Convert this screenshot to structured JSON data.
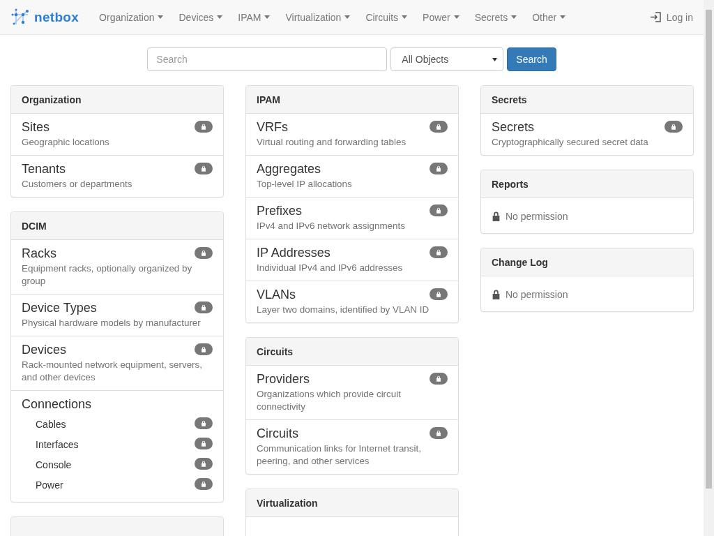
{
  "navbar": {
    "brand": "netbox",
    "menus": [
      {
        "label": "Organization"
      },
      {
        "label": "Devices"
      },
      {
        "label": "IPAM"
      },
      {
        "label": "Virtualization"
      },
      {
        "label": "Circuits"
      },
      {
        "label": "Power"
      },
      {
        "label": "Secrets"
      },
      {
        "label": "Other"
      }
    ],
    "login": "Log in"
  },
  "search": {
    "placeholder": "Search",
    "scope": "All Objects",
    "button": "Search"
  },
  "columns": [
    {
      "panels": [
        {
          "kind": "list",
          "title": "Organization",
          "items": [
            {
              "title": "Sites",
              "description": "Geographic locations",
              "locked": true
            },
            {
              "title": "Tenants",
              "description": "Customers or departments",
              "locked": true
            }
          ]
        },
        {
          "kind": "list",
          "title": "DCIM",
          "items": [
            {
              "title": "Racks",
              "description": "Equipment racks, optionally organized by group",
              "locked": true
            },
            {
              "title": "Device Types",
              "description": "Physical hardware models by manufacturer",
              "locked": true
            },
            {
              "title": "Devices",
              "description": "Rack-mounted network equipment, servers, and other devices",
              "locked": true
            },
            {
              "title": "Connections",
              "children": [
                {
                  "title": "Cables",
                  "locked": true
                },
                {
                  "title": "Interfaces",
                  "locked": true
                },
                {
                  "title": "Console",
                  "locked": true
                },
                {
                  "title": "Power",
                  "locked": true
                }
              ]
            }
          ]
        },
        {
          "kind": "list"
        }
      ]
    },
    {
      "panels": [
        {
          "kind": "list",
          "title": "IPAM",
          "items": [
            {
              "title": "VRFs",
              "description": "Virtual routing and forwarding tables",
              "locked": true
            },
            {
              "title": "Aggregates",
              "description": "Top-level IP allocations",
              "locked": true
            },
            {
              "title": "Prefixes",
              "description": "IPv4 and IPv6 network assignments",
              "locked": true
            },
            {
              "title": "IP Addresses",
              "description": "Individual IPv4 and IPv6 addresses",
              "locked": true
            },
            {
              "title": "VLANs",
              "description": "Layer two domains, identified by VLAN ID",
              "locked": true
            }
          ]
        },
        {
          "kind": "list",
          "title": "Circuits",
          "items": [
            {
              "title": "Providers",
              "description": "Organizations which provide circuit connectivity",
              "locked": true
            },
            {
              "title": "Circuits",
              "description": "Communication links for Internet transit, peering, and other services",
              "locked": true
            }
          ]
        },
        {
          "kind": "list",
          "title": "Virtualization"
        }
      ]
    },
    {
      "panels": [
        {
          "kind": "list",
          "title": "Secrets",
          "items": [
            {
              "title": "Secrets",
              "description": "Cryptographically secured secret data",
              "locked": true
            }
          ]
        },
        {
          "kind": "message",
          "title": "Reports",
          "message": "No permission"
        },
        {
          "kind": "message",
          "title": "Change Log",
          "message": "No permission"
        }
      ]
    }
  ]
}
